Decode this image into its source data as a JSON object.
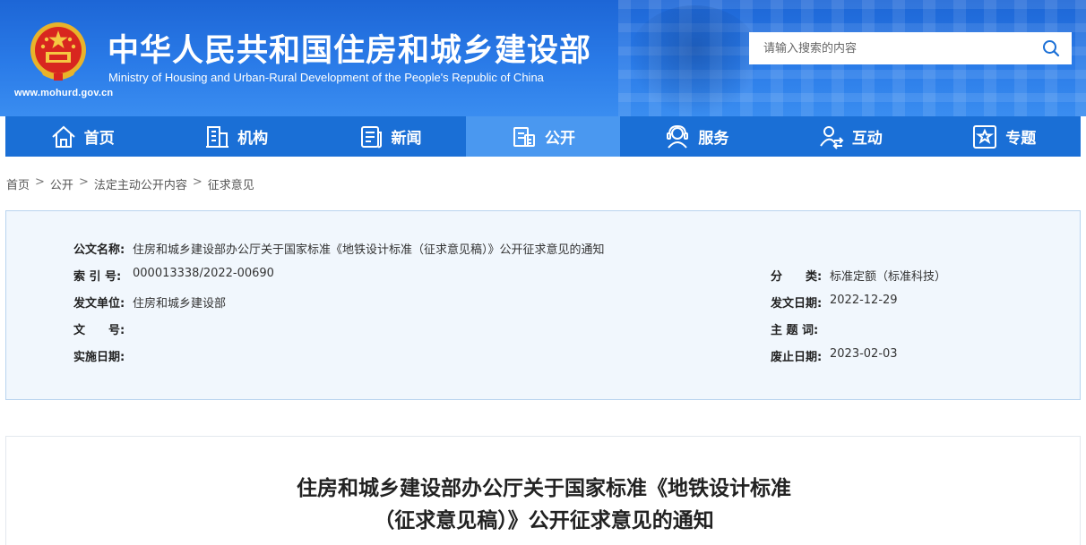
{
  "header": {
    "cn_title": "中华人民共和国住房和城乡建设部",
    "en_title": "Ministry of Housing and Urban-Rural Development of the People's Republic of China",
    "site_url": "www.mohurd.gov.cn",
    "search_placeholder": "请输入搜索的内容"
  },
  "nav": {
    "items": [
      {
        "label": "首页",
        "icon": "home-icon"
      },
      {
        "label": "机构",
        "icon": "building-icon"
      },
      {
        "label": "新闻",
        "icon": "news-icon"
      },
      {
        "label": "公开",
        "icon": "document-icon",
        "active": true
      },
      {
        "label": "服务",
        "icon": "service-icon"
      },
      {
        "label": "互动",
        "icon": "interaction-icon"
      },
      {
        "label": "专题",
        "icon": "star-icon"
      }
    ]
  },
  "breadcrumb": {
    "items": [
      "首页",
      "公开",
      "法定主动公开内容",
      "征求意见"
    ],
    "separator": ">"
  },
  "meta": {
    "doc_name_label": "公文名称:",
    "doc_name": "住房和城乡建设部办公厅关于国家标准《地铁设计标准（征求意见稿）》公开征求意见的通知",
    "index_label": "索 引 号:",
    "index": "000013338/2022-00690",
    "category_label": "分　　类:",
    "category": "标准定额（标准科技）",
    "issuer_label": "发文单位:",
    "issuer": "住房和城乡建设部",
    "issue_date_label": "发文日期:",
    "issue_date": "2022-12-29",
    "doc_no_label": "文　　号:",
    "doc_no": "",
    "keywords_label": "主 题 词:",
    "keywords": "",
    "effective_label": "实施日期:",
    "effective": "",
    "expire_label": "废止日期:",
    "expire": "2023-02-03"
  },
  "article": {
    "title_line1": "住房和城乡建设部办公厅关于国家标准《地铁设计标准",
    "title_line2": "（征求意见稿）》公开征求意见的通知"
  },
  "colors": {
    "header_blue": "#2a7be8",
    "nav_blue": "#1a6fd6",
    "nav_active": "#4a98f0",
    "meta_bg": "#f1f7fd"
  }
}
